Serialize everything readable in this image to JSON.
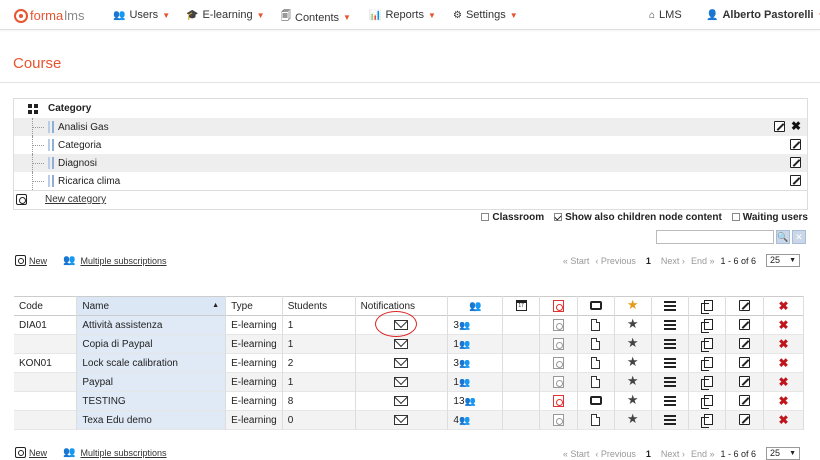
{
  "nav": {
    "logo_text": "forma",
    "logo_suffix": "lms",
    "users": "Users",
    "elearning": "E-learning",
    "contents": "Contents",
    "reports": "Reports",
    "settings": "Settings",
    "lms": "LMS",
    "user": "Alberto Pastorelli"
  },
  "page": {
    "title": "Course"
  },
  "category_panel": {
    "header": "Category",
    "items": [
      {
        "label": "Analisi Gas"
      },
      {
        "label": "Categoria"
      },
      {
        "label": "Diagnosi"
      },
      {
        "label": "Ricarica clima"
      }
    ],
    "new_category": "New category"
  },
  "filters": {
    "classroom": "Classroom",
    "show_children": "Show also children node content",
    "waiting_users": "Waiting users"
  },
  "actions": {
    "new": "New",
    "multiple_subscriptions": "Multiple subscriptions"
  },
  "pager": {
    "start": "« Start",
    "previous": "‹ Previous",
    "current": "1",
    "next": "Next ›",
    "end": "End »",
    "range": "1 - 6 of 6",
    "page_size": "25"
  },
  "table": {
    "headers": {
      "code": "Code",
      "name": "Name",
      "type": "Type",
      "students": "Students",
      "notifications": "Notifications"
    },
    "rows": [
      {
        "code": "DIA01",
        "name": "Attività assistenza",
        "type": "E-learning",
        "students": "1",
        "subs": "3",
        "pdf_active": false,
        "printer": false,
        "star_active": false
      },
      {
        "code": "",
        "name": "Copia di Paypal",
        "type": "E-learning",
        "students": "1",
        "subs": "1",
        "pdf_active": false,
        "printer": false,
        "star_active": false
      },
      {
        "code": "KON01",
        "name": "Lock scale calibration",
        "type": "E-learning",
        "students": "2",
        "subs": "3",
        "pdf_active": false,
        "printer": false,
        "star_active": false
      },
      {
        "code": "",
        "name": "Paypal",
        "type": "E-learning",
        "students": "1",
        "subs": "1",
        "pdf_active": false,
        "printer": false,
        "star_active": false
      },
      {
        "code": "",
        "name": "TESTING",
        "type": "E-learning",
        "students": "8",
        "subs": "13",
        "pdf_active": true,
        "printer": true,
        "star_active": false
      },
      {
        "code": "",
        "name": "Texa Edu demo",
        "type": "E-learning",
        "students": "0",
        "subs": "4",
        "pdf_active": false,
        "printer": false,
        "star_active": false
      }
    ]
  },
  "colors": {
    "brand": "#e8542f",
    "delete": "#c0161b",
    "name_highlight": "#e0eaf7"
  }
}
